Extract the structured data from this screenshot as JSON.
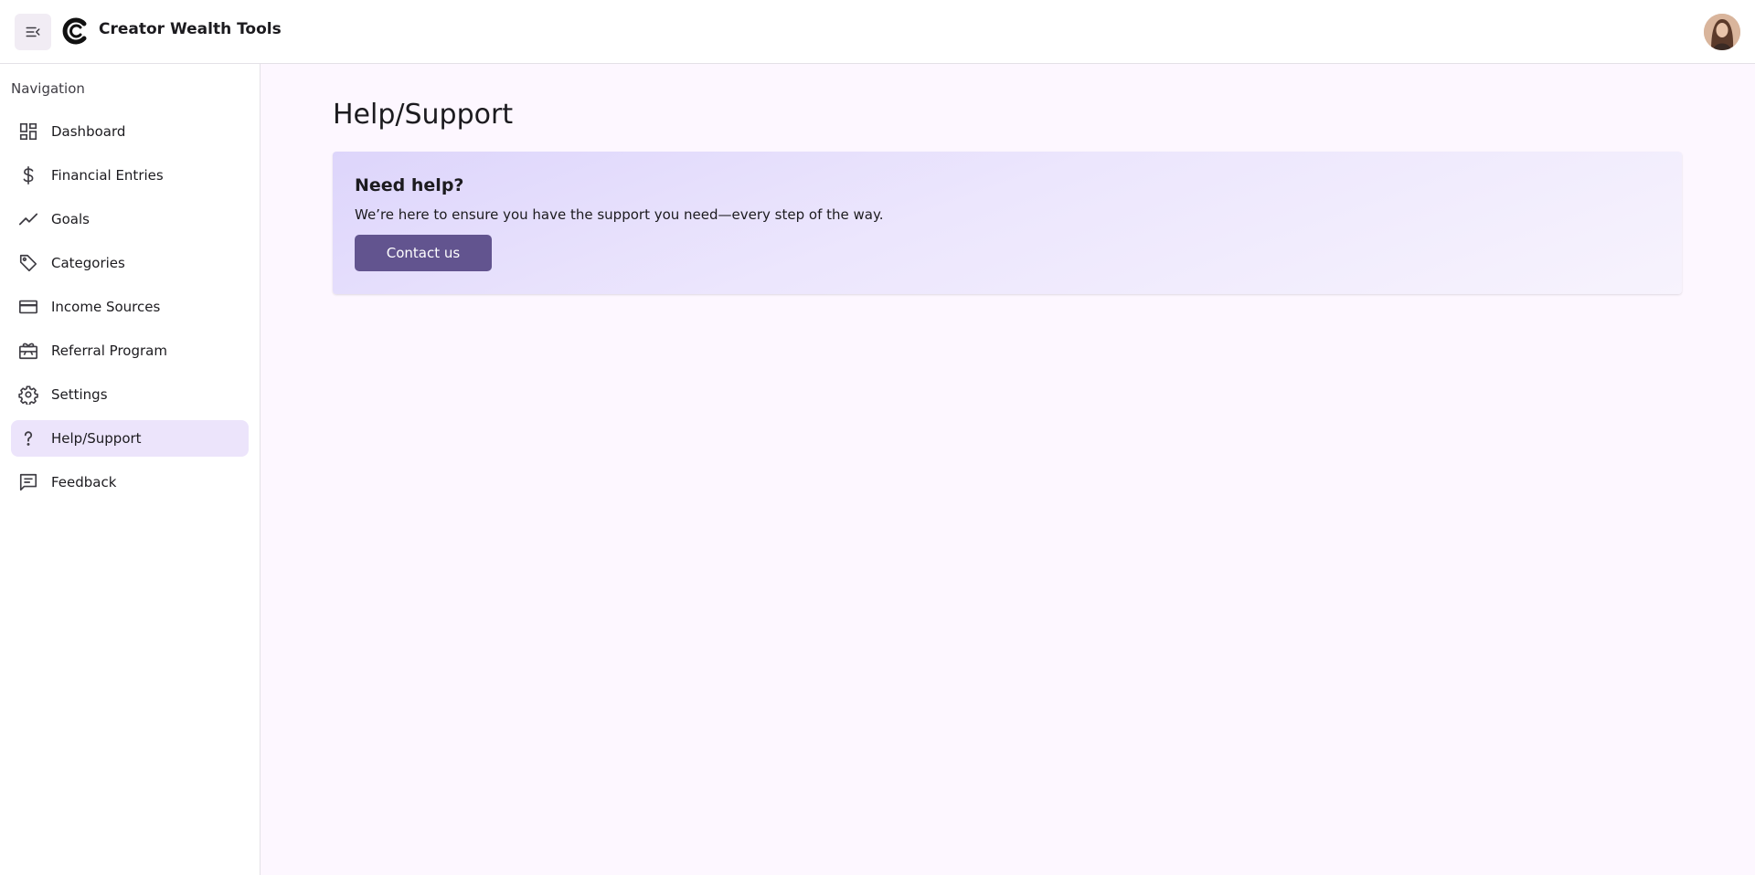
{
  "header": {
    "app_title": "Creator Wealth Tools",
    "menu_icon": "menu-collapse-icon",
    "logo_icon": "brand-logo-icon",
    "avatar": "user-avatar"
  },
  "sidebar": {
    "heading": "Navigation",
    "items": [
      {
        "label": "Dashboard",
        "icon": "dashboard-icon"
      },
      {
        "label": "Financial Entries",
        "icon": "dollar-icon"
      },
      {
        "label": "Goals",
        "icon": "trending-up-icon"
      },
      {
        "label": "Categories",
        "icon": "tag-icon"
      },
      {
        "label": "Income Sources",
        "icon": "credit-card-icon"
      },
      {
        "label": "Referral Program",
        "icon": "gift-card-icon"
      },
      {
        "label": "Settings",
        "icon": "gear-icon"
      },
      {
        "label": "Help/Support",
        "icon": "question-icon",
        "active": true
      },
      {
        "label": "Feedback",
        "icon": "feedback-icon"
      }
    ]
  },
  "main": {
    "page_title": "Help/Support",
    "card": {
      "title": "Need help?",
      "text": "We’re here to ensure you have the support you need—every step of the way.",
      "button_label": "Contact us"
    }
  },
  "colors": {
    "accent": "#62548f",
    "active_nav_bg": "#ece4fb",
    "page_bg": "#fdf7ff",
    "card_gradient_start": "#ddd5fb",
    "card_gradient_end": "#f7f3fd"
  }
}
